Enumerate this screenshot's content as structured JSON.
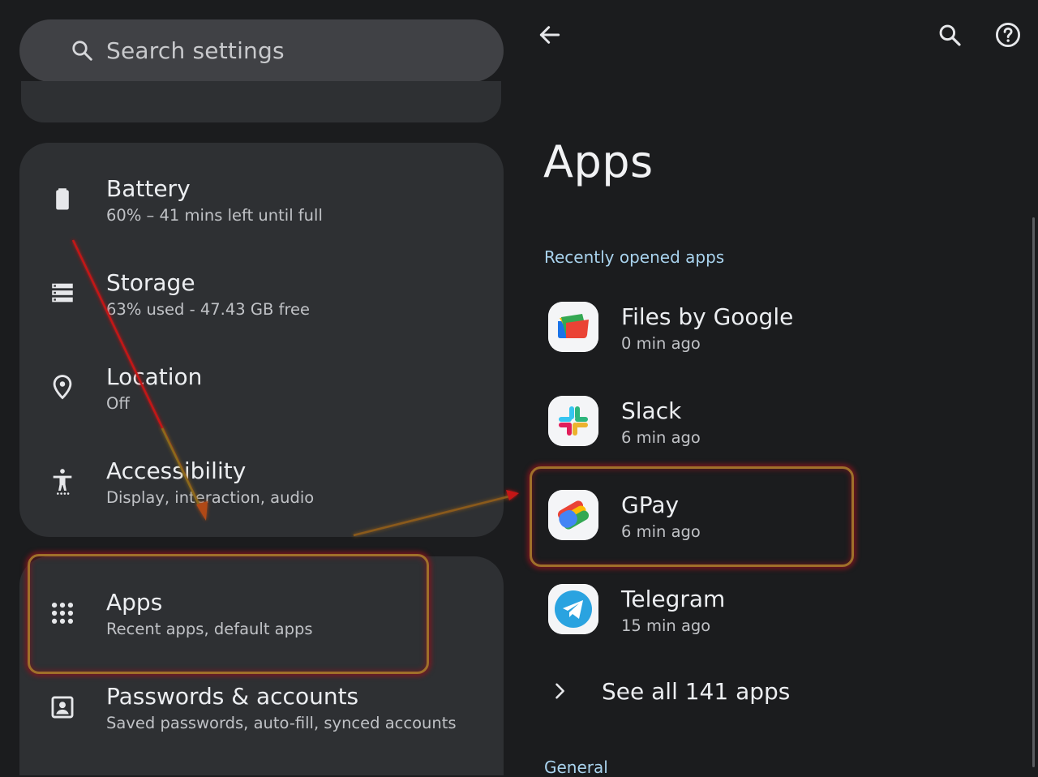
{
  "search": {
    "placeholder": "Search settings"
  },
  "settings": {
    "items": [
      {
        "title": "Battery",
        "subtitle": "60% – 41 mins left until full",
        "icon": "battery-icon"
      },
      {
        "title": "Storage",
        "subtitle": "63% used - 47.43 GB free",
        "icon": "storage-icon"
      },
      {
        "title": "Location",
        "subtitle": "Off",
        "icon": "location-pin-icon"
      },
      {
        "title": "Accessibility",
        "subtitle": "Display, interaction, audio",
        "icon": "accessibility-icon"
      },
      {
        "title": "Apps",
        "subtitle": "Recent apps, default apps",
        "icon": "apps-grid-icon"
      },
      {
        "title": "Passwords & accounts",
        "subtitle": "Saved passwords, auto-fill, synced accounts",
        "icon": "account-box-icon"
      }
    ]
  },
  "apps_page": {
    "title": "Apps",
    "recent_header": "Recently opened apps",
    "recent_apps": [
      {
        "name": "Files by Google",
        "time": "0 min ago",
        "icon": "files-by-google-icon"
      },
      {
        "name": "Slack",
        "time": "6 min ago",
        "icon": "slack-icon"
      },
      {
        "name": "GPay",
        "time": "6 min ago",
        "icon": "gpay-icon"
      },
      {
        "name": "Telegram",
        "time": "15 min ago",
        "icon": "telegram-icon"
      }
    ],
    "see_all": "See all 141 apps",
    "general_header": "General"
  },
  "toolbar": {
    "back_icon": "back-arrow-icon",
    "search_icon": "search-icon",
    "help_icon": "help-icon"
  },
  "colors": {
    "background": "#1b1c1e",
    "card": "#2e3033",
    "search_bar": "#404145",
    "section_header": "#a9d3ee",
    "annotation_arrow": "#d01010",
    "annotation_box": "#a0702a"
  }
}
